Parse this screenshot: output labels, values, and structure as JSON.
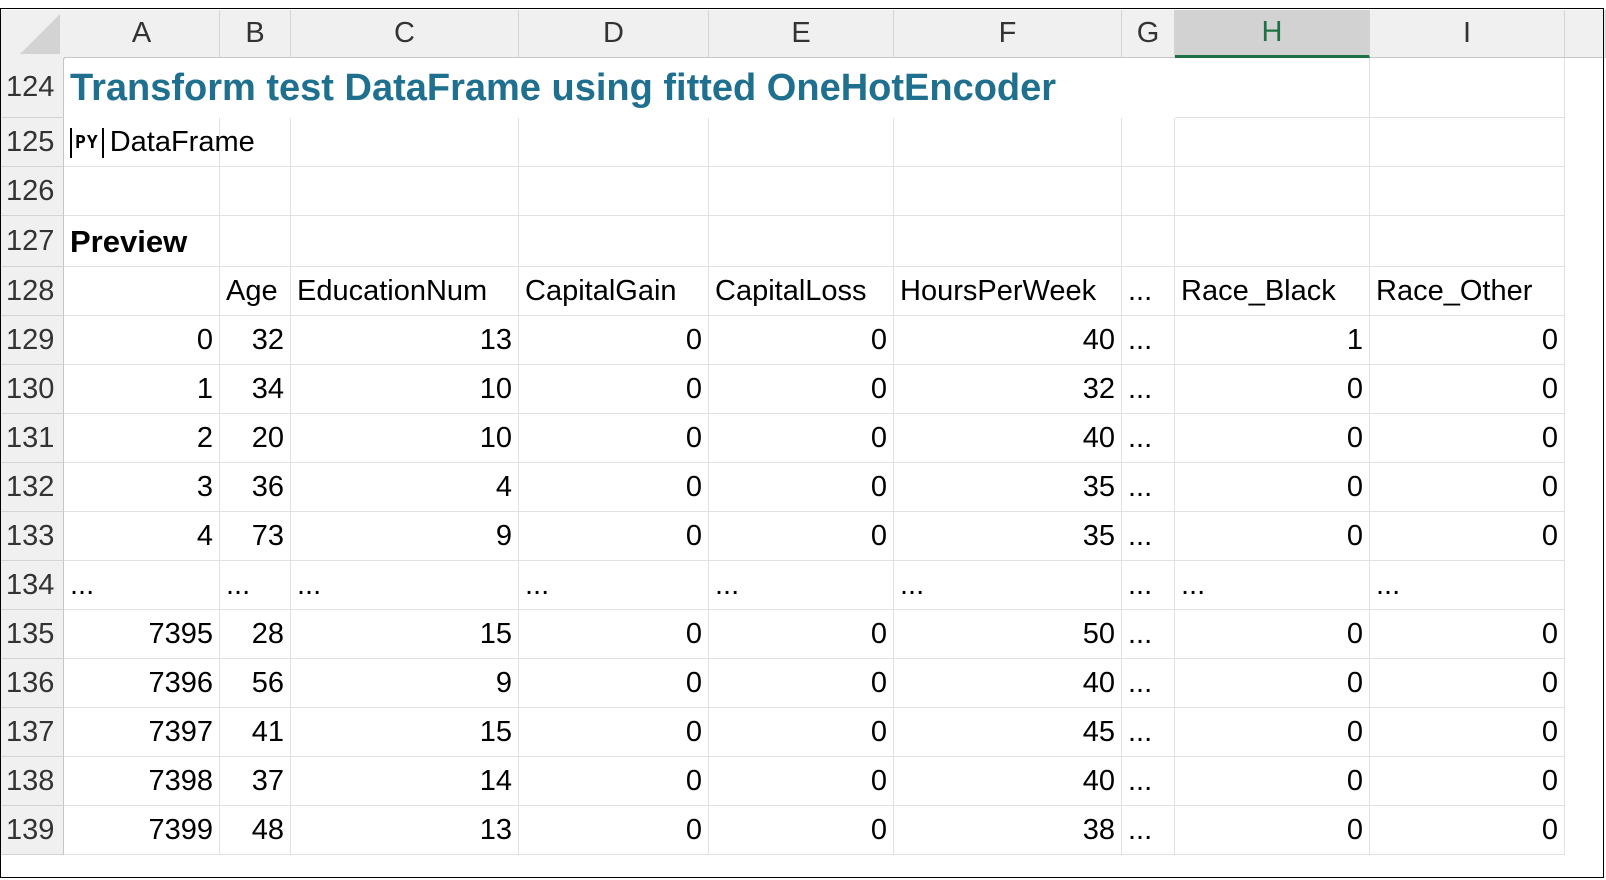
{
  "columns": [
    "A",
    "B",
    "C",
    "D",
    "E",
    "F",
    "G",
    "H",
    "I"
  ],
  "selected_column": "H",
  "rows": [
    "124",
    "125",
    "126",
    "127",
    "128",
    "129",
    "130",
    "131",
    "132",
    "133",
    "134",
    "135",
    "136",
    "137",
    "138",
    "139"
  ],
  "title": "Transform test DataFrame using fitted OneHotEncoder",
  "py_badge": "PY",
  "py_label": "DataFrame",
  "preview_label": "Preview",
  "table": {
    "headers": [
      "",
      "Age",
      "EducationNum",
      "CapitalGain",
      "CapitalLoss",
      "HoursPerWeek",
      "...",
      "Race_Black",
      "Race_Other"
    ],
    "rows": [
      [
        "0",
        "32",
        "13",
        "0",
        "0",
        "40",
        "...",
        "1",
        "0"
      ],
      [
        "1",
        "34",
        "10",
        "0",
        "0",
        "32",
        "...",
        "0",
        "0"
      ],
      [
        "2",
        "20",
        "10",
        "0",
        "0",
        "40",
        "...",
        "0",
        "0"
      ],
      [
        "3",
        "36",
        "4",
        "0",
        "0",
        "35",
        "...",
        "0",
        "0"
      ],
      [
        "4",
        "73",
        "9",
        "0",
        "0",
        "35",
        "...",
        "0",
        "0"
      ],
      [
        "...",
        "...",
        "...",
        "...",
        "...",
        "...",
        "...",
        "...",
        "..."
      ],
      [
        "7395",
        "28",
        "15",
        "0",
        "0",
        "50",
        "...",
        "0",
        "0"
      ],
      [
        "7396",
        "56",
        "9",
        "0",
        "0",
        "40",
        "...",
        "0",
        "0"
      ],
      [
        "7397",
        "41",
        "15",
        "0",
        "0",
        "45",
        "...",
        "0",
        "0"
      ],
      [
        "7398",
        "37",
        "14",
        "0",
        "0",
        "40",
        "...",
        "0",
        "0"
      ],
      [
        "7399",
        "48",
        "13",
        "0",
        "0",
        "38",
        "...",
        "0",
        "0"
      ]
    ]
  },
  "colors": {
    "title": "#1f6f8f",
    "selected_header": "#1e7145"
  }
}
